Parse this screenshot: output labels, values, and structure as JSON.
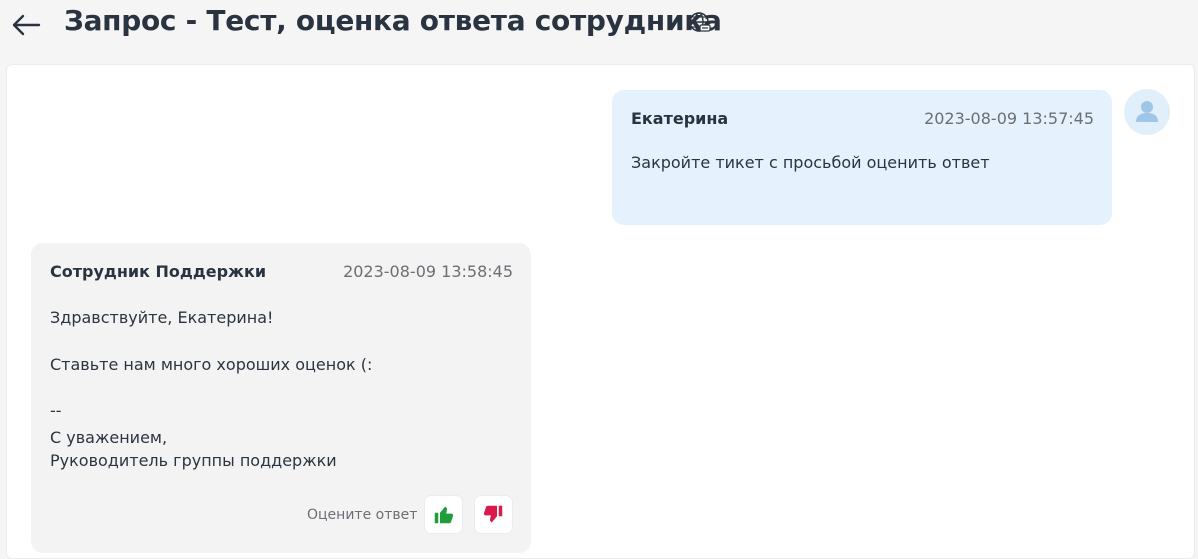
{
  "header": {
    "title": "Запрос - Тест, оценка ответа сотрудника",
    "back_icon": "arrow-left-icon",
    "language_icon": "globe-icon"
  },
  "messages": [
    {
      "author": "Екатерина",
      "timestamp": "2023-08-09 13:57:45",
      "lines": [
        "Закройте тикет с просьбой оценить ответ"
      ]
    },
    {
      "author": "Сотрудник Поддержки",
      "timestamp": "2023-08-09 13:58:45",
      "lines": [
        "Здравствуйте, Екатерина!",
        "Ставьте нам много хороших оценок (:",
        "--",
        "С уважением,",
        "Руководитель группы поддержки"
      ]
    }
  ],
  "rating": {
    "label": "Оцените ответ",
    "like_icon": "thumbs-up-icon",
    "dislike_icon": "thumbs-down-icon"
  },
  "colors": {
    "title": "#2a3441",
    "user_bubble": "#e5f1fc",
    "agent_bubble": "#f3f3f3",
    "like": "#1f9d3a",
    "dislike": "#d81b4a",
    "avatar_bg": "#e1effa",
    "avatar_fg": "#9fc6e6"
  }
}
